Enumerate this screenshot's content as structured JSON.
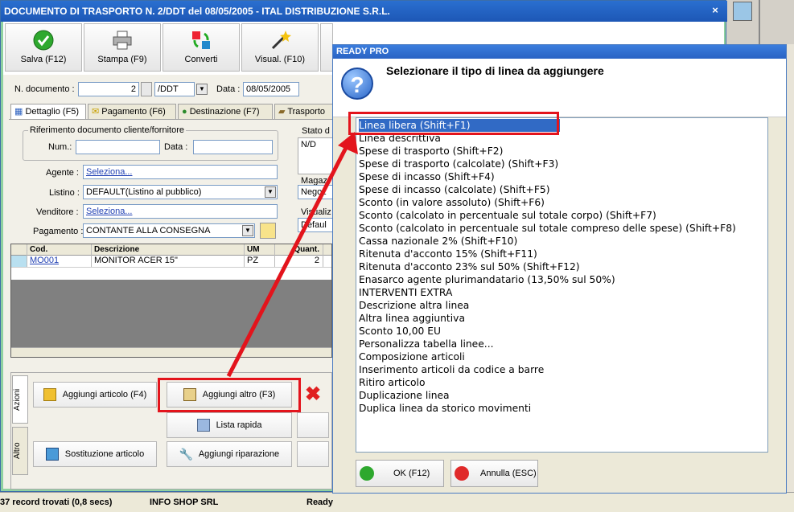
{
  "window": {
    "title": "DOCUMENTO DI TRASPORTO N. 2/DDT del 08/05/2005 - ITAL DISTRIBUZIONE S.R.L.",
    "close": "×"
  },
  "toolbar": {
    "buttons": [
      {
        "label": "Salva (F12)",
        "icon": "check-icon"
      },
      {
        "label": "Stampa (F9)",
        "icon": "printer-icon"
      },
      {
        "label": "Converti",
        "icon": "convert-icon"
      },
      {
        "label": "Visual. (F10)",
        "icon": "magic-wand-icon"
      }
    ]
  },
  "header": {
    "doc_label": "N. documento :",
    "doc_number": "2",
    "doc_series": "/DDT",
    "date_label": "Data :",
    "date_value": "08/05/2005"
  },
  "tabs": [
    {
      "label": "Dettaglio (F5)"
    },
    {
      "label": "Pagamento (F6)"
    },
    {
      "label": "Destinazione (F7)"
    },
    {
      "label": "Trasporto"
    }
  ],
  "form": {
    "rif_title": "Riferimento documento cliente/fornitore",
    "num_label": "Num.:",
    "num_value": "",
    "data_label": "Data :",
    "data_value": "",
    "stato_label": "Stato d",
    "stato_value": "N/D",
    "agente_label": "Agente :",
    "agente_value": "Seleziona...",
    "listino_label": "Listino :",
    "listino_value": "DEFAULT(Listino al pubblico)",
    "venditore_label": "Venditore :",
    "venditore_value": "Seleziona...",
    "pagamento_label": "Pagamento :",
    "pagamento_value": "CONTANTE ALLA CONSEGNA",
    "magaz_label": "Magaz",
    "magaz_value": "Negoz",
    "visual_label": "Visualiz",
    "visual_value": "Defaul"
  },
  "grid": {
    "columns": [
      "Cod.",
      "Descrizione",
      "UM",
      "Quant."
    ],
    "rows": [
      {
        "cod": "MO001",
        "descrizione": "MONITOR ACER 15\"",
        "um": "PZ",
        "quant": "2"
      }
    ]
  },
  "actions": {
    "tab_azioni": "Azioni",
    "tab_altro": "Altro",
    "aggiungi_articolo": "Aggiungi articolo (F4)",
    "aggiungi_altro": "Aggiungi altro (F3)",
    "lista_rapida": "Lista rapida",
    "sostituzione_articolo": "Sostituzione articolo",
    "aggiungi_riparazione": "Aggiungi riparazione"
  },
  "status": {
    "records": "37 record trovati (0,8 secs)",
    "company": "INFO SHOP SRL",
    "ready": "Ready"
  },
  "dialog": {
    "title": "READY PRO",
    "heading": "Selezionare il tipo di linea da aggiungere",
    "items": [
      "Linea libera (Shift+F1)",
      "Linea descrittiva",
      "Spese di trasporto (Shift+F2)",
      "Spese di trasporto (calcolate) (Shift+F3)",
      "Spese di incasso (Shift+F4)",
      "Spese di incasso (calcolate) (Shift+F5)",
      "Sconto (in valore assoluto) (Shift+F6)",
      "Sconto (calcolato in percentuale sul totale corpo) (Shift+F7)",
      "Sconto (calcolato in percentuale sul totale compreso delle spese) (Shift+F8)",
      "Cassa nazionale 2% (Shift+F10)",
      "Ritenuta d'acconto 15% (Shift+F11)",
      "Ritenuta d'acconto 23% sul 50% (Shift+F12)",
      "Enasarco agente plurimandatario (13,50% sul 50%)",
      "INTERVENTI EXTRA",
      "Descrizione altra linea",
      "Altra linea aggiuntiva",
      "Sconto 10,00 EU",
      "Personalizza tabella linee...",
      "Composizione articoli",
      "Inserimento articoli da codice a barre",
      "Ritiro articolo",
      "Duplicazione linea",
      "Duplica linea da storico movimenti"
    ],
    "ok": "OK (F12)",
    "cancel": "Annulla (ESC)"
  },
  "colors": {
    "highlight_red": "#e3141c",
    "selection_blue": "#316ac5",
    "window_green": "#8fd1a0"
  }
}
